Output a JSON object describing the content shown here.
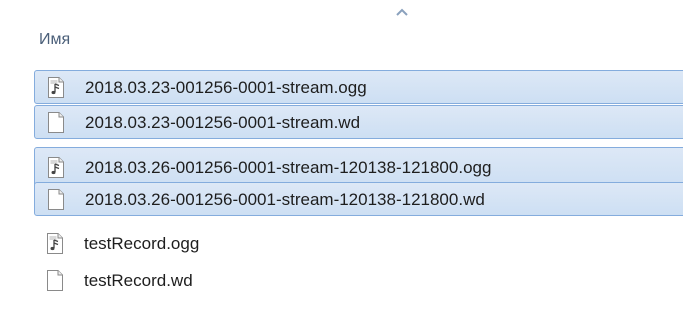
{
  "header": {
    "column_name": "Имя",
    "sort_icon": "sort-ascending-icon"
  },
  "files": [
    {
      "name": "2018.03.23-001256-0001-stream.ogg",
      "type": "ogg",
      "icon": "audio-file-icon",
      "selected": true
    },
    {
      "name": "2018.03.23-001256-0001-stream.wd",
      "type": "wd",
      "icon": "blank-file-icon",
      "selected": true
    },
    {
      "name": "2018.03.26-001256-0001-stream-120138-121800.ogg",
      "type": "ogg",
      "icon": "audio-file-icon",
      "selected": true
    },
    {
      "name": "2018.03.26-001256-0001-stream-120138-121800.wd",
      "type": "wd",
      "icon": "blank-file-icon",
      "selected": true
    },
    {
      "name": "testRecord.ogg",
      "type": "ogg",
      "icon": "audio-file-icon",
      "selected": false
    },
    {
      "name": "testRecord.wd",
      "type": "wd",
      "icon": "blank-file-icon",
      "selected": false
    }
  ]
}
